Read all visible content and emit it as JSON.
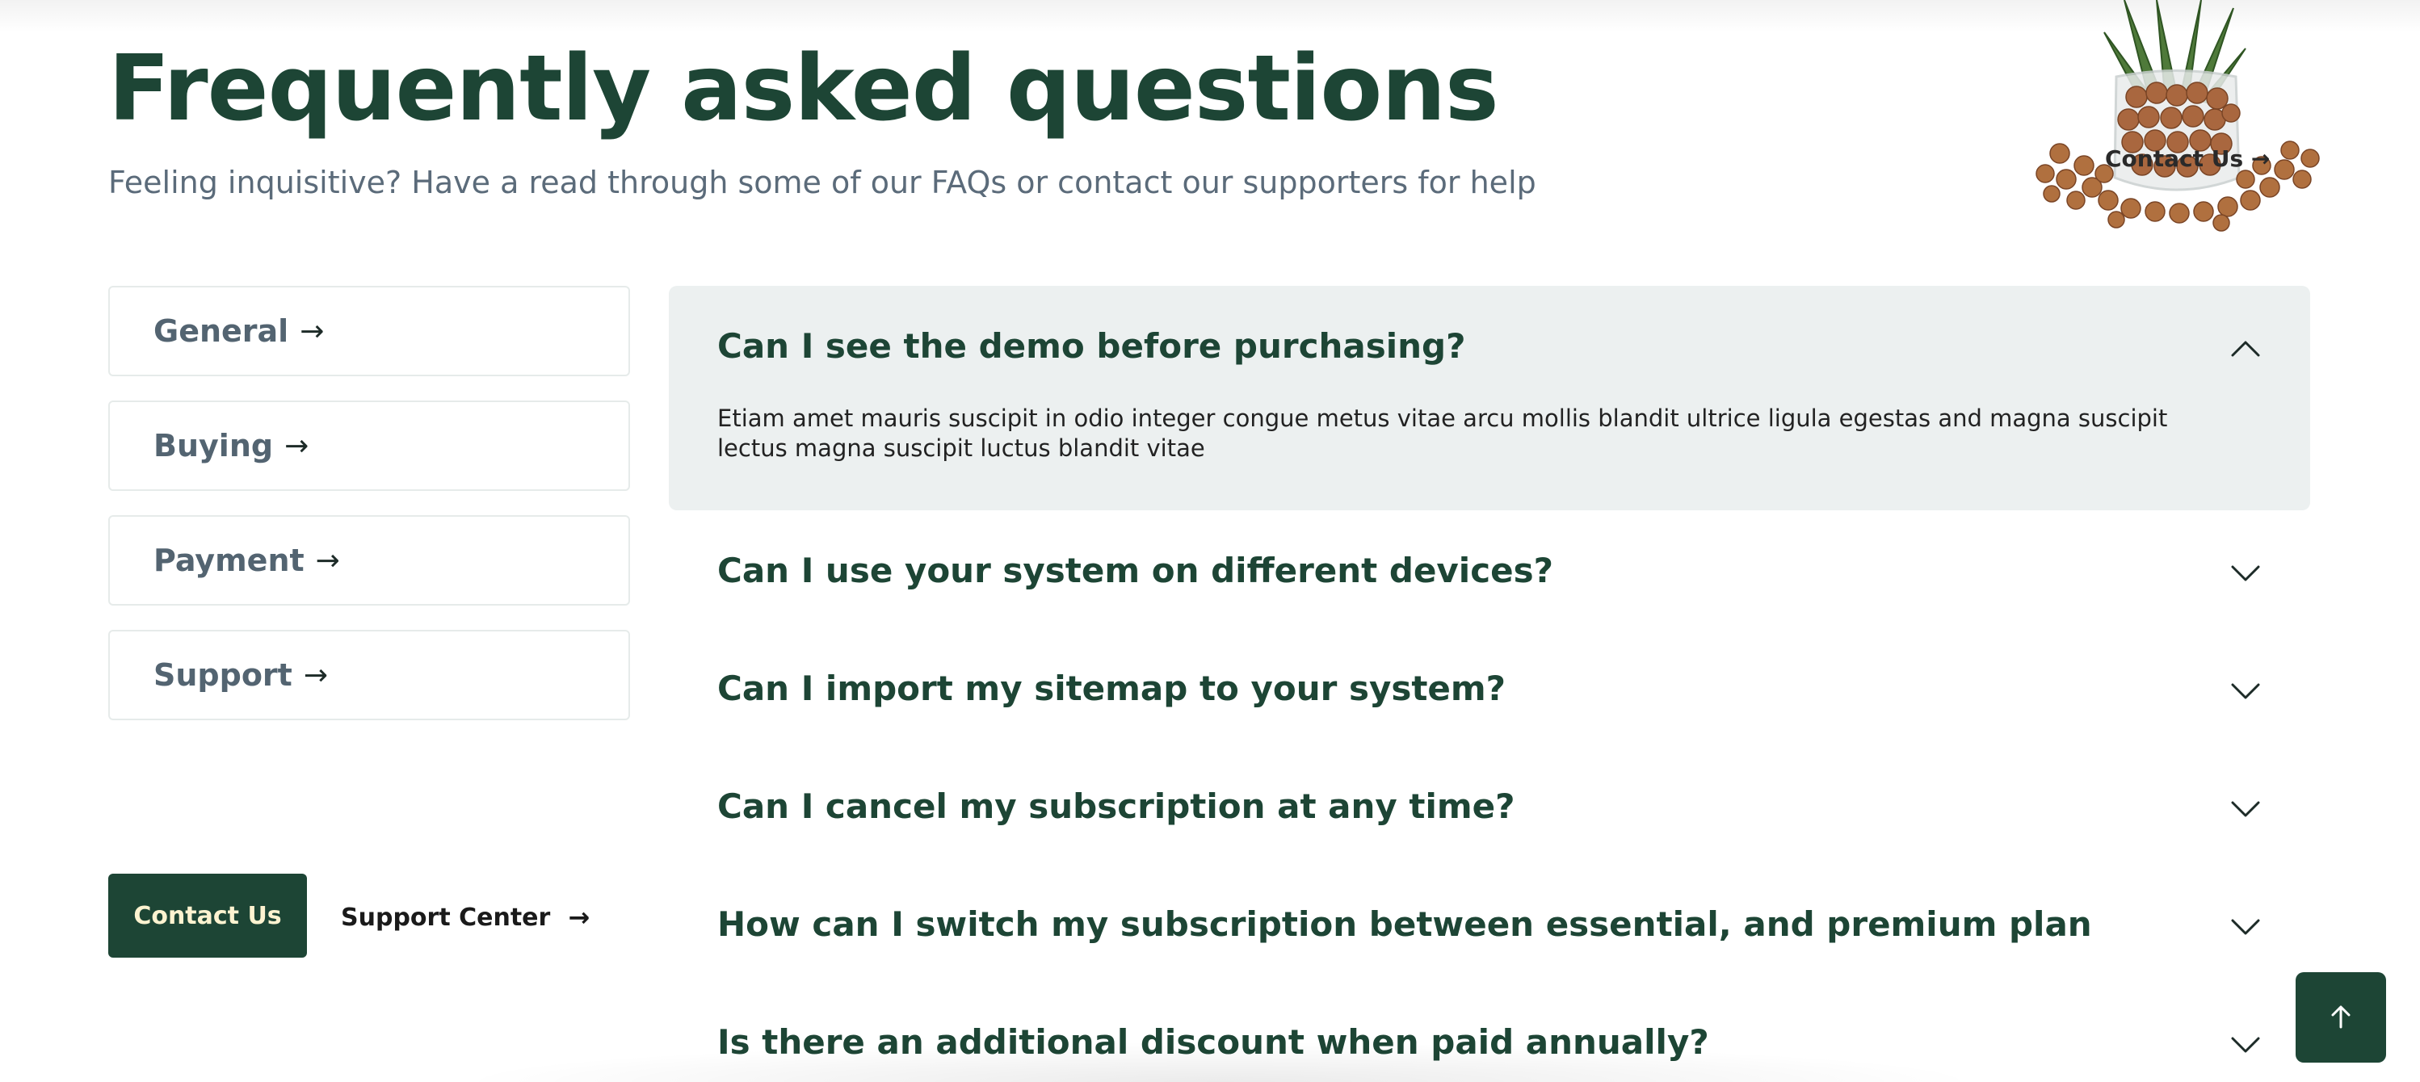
{
  "header": {
    "title": "Frequently asked questions",
    "subtitle": "Feeling inquisitive? Have a read through some of our FAQs or contact our supporters for help"
  },
  "illustration": {
    "link_label": "Contact Us",
    "icon": "plant-illustration"
  },
  "categories": [
    {
      "label": "General",
      "icon": "arrow-right-icon"
    },
    {
      "label": "Buying",
      "icon": "arrow-right-icon"
    },
    {
      "label": "Payment",
      "icon": "arrow-right-icon"
    },
    {
      "label": "Support",
      "icon": "arrow-right-icon"
    }
  ],
  "actions": {
    "contact_label": "Contact Us",
    "support_label": "Support Center"
  },
  "faqs": [
    {
      "question": "Can I see the demo before purchasing?",
      "expanded": true,
      "answer": "Etiam amet mauris suscipit in odio integer congue metus vitae arcu mollis blandit ultrice ligula egestas and magna suscipit lectus magna suscipit luctus blandit vitae"
    },
    {
      "question": "Can I use your system on different devices?",
      "expanded": false
    },
    {
      "question": "Can I import my sitemap to your system?",
      "expanded": false
    },
    {
      "question": "Can I cancel my subscription at any time?",
      "expanded": false
    },
    {
      "question": "How can I switch my subscription between essential, and premium plan",
      "expanded": false
    },
    {
      "question": "Is there an additional discount when paid annually?",
      "expanded": false
    }
  ],
  "colors": {
    "brand_green": "#1d4535",
    "button_text": "#fdf3d0",
    "panel_bg": "#ecf0f0",
    "muted_text": "#5b6b7a"
  }
}
